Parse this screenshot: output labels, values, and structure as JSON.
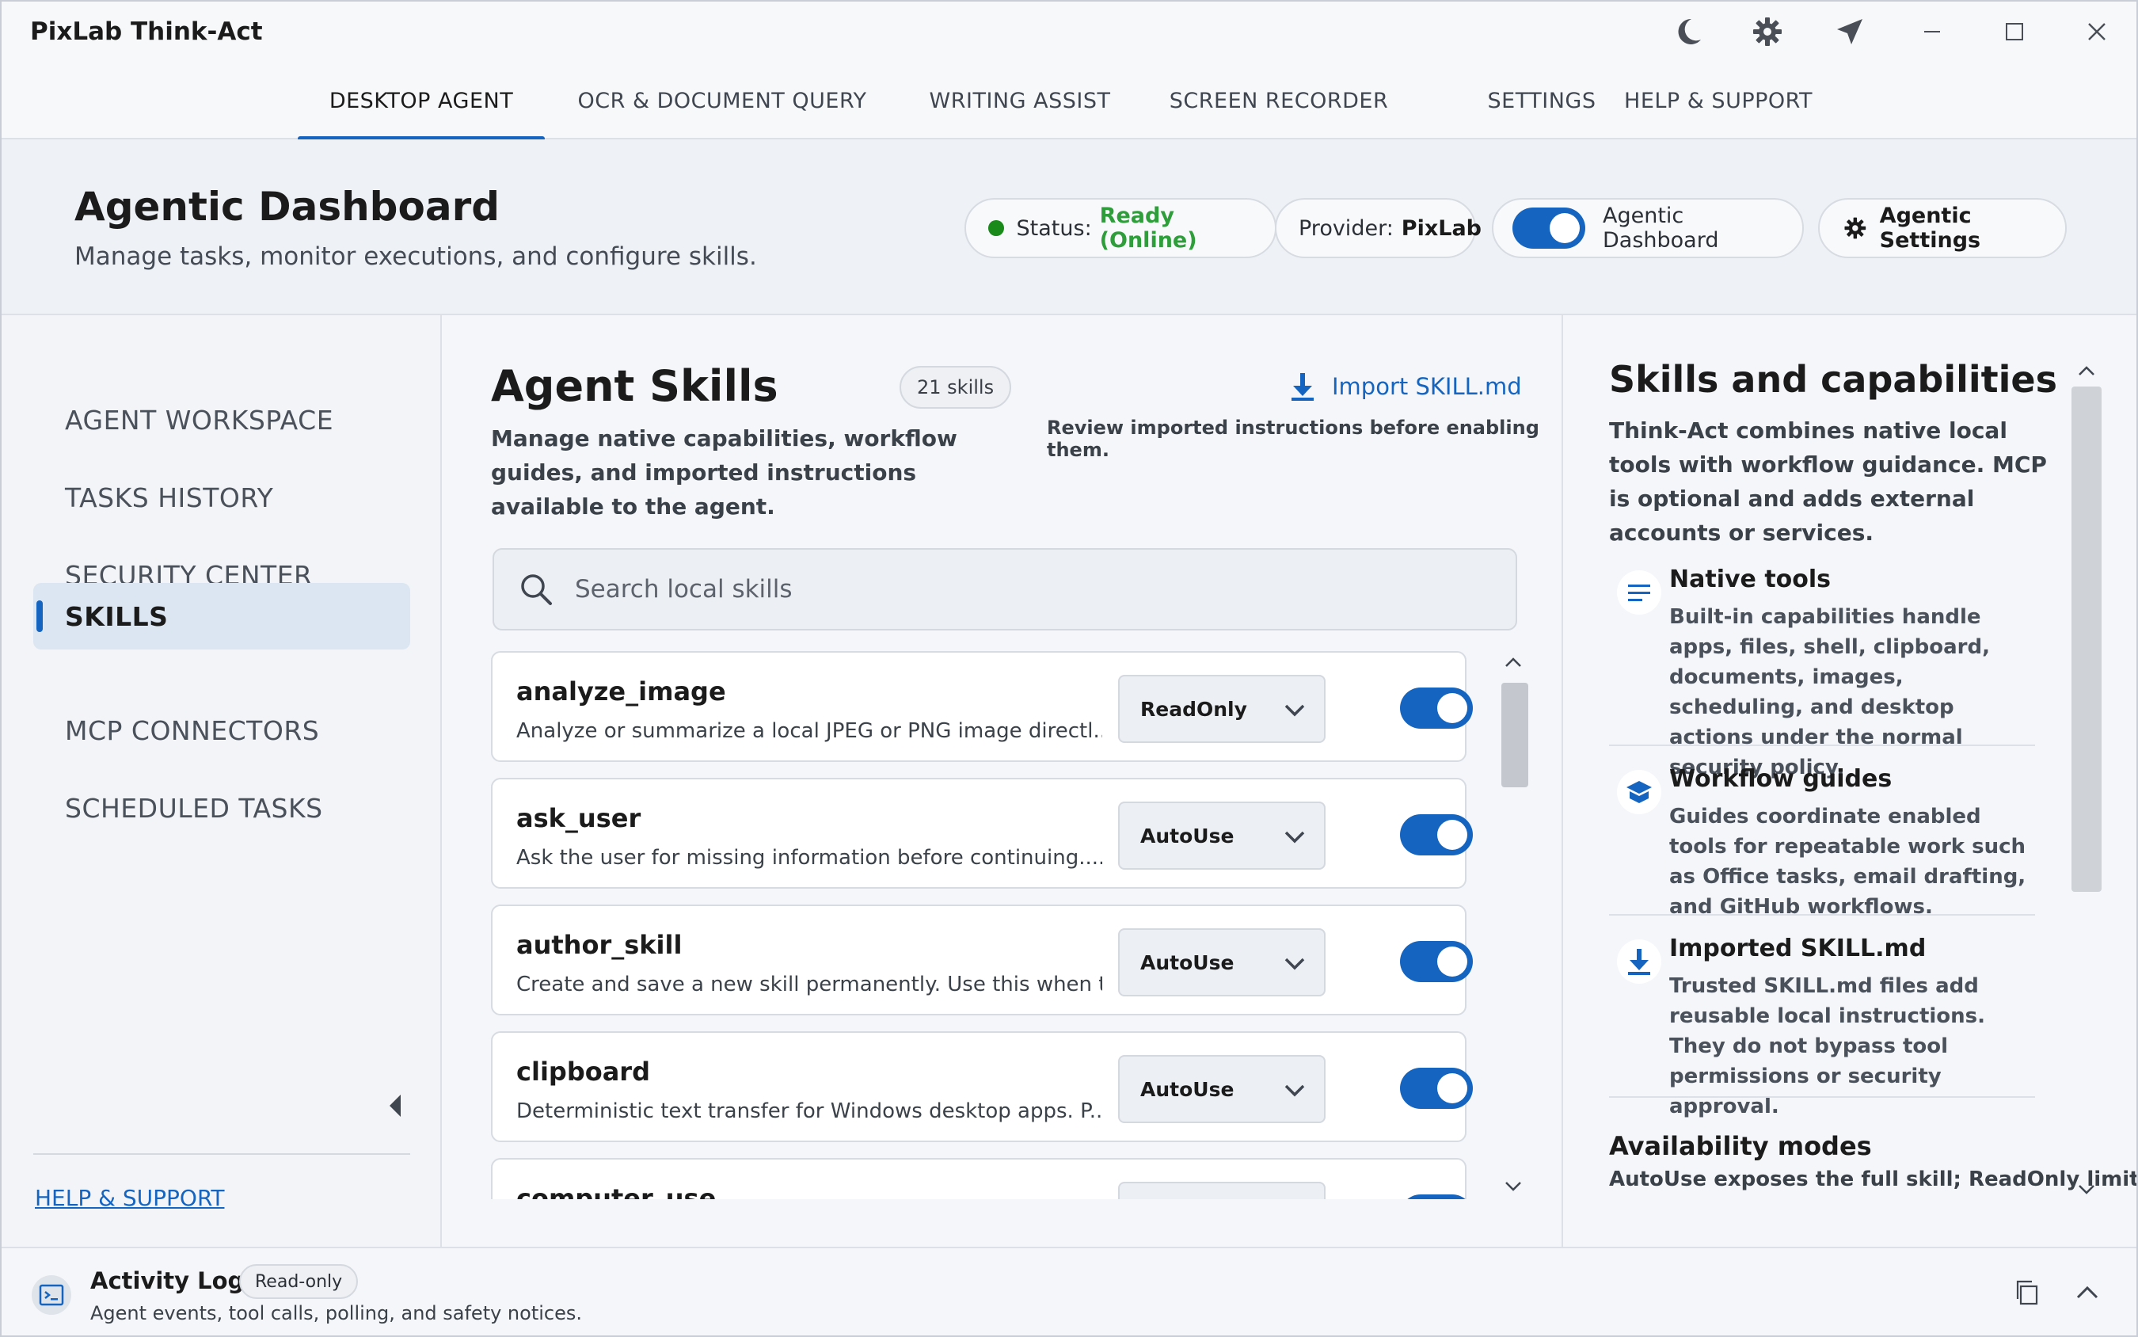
{
  "app": {
    "title": "PixLab Think-Act",
    "title_icons": [
      "moon-icon",
      "gear-icon",
      "send-icon",
      "minimize-icon",
      "maximize-icon",
      "close-icon"
    ]
  },
  "main_tabs": [
    {
      "label": "DESKTOP AGENT",
      "active": true
    },
    {
      "label": "OCR & DOCUMENT QUERY",
      "active": false
    },
    {
      "label": "WRITING ASSIST",
      "active": false
    },
    {
      "label": "SCREEN RECORDER",
      "active": false
    },
    {
      "label": "SETTINGS",
      "active": false
    },
    {
      "label": "HELP & SUPPORT",
      "active": false
    }
  ],
  "header": {
    "title": "Agentic Dashboard",
    "subtitle": "Manage tasks, monitor executions, and configure skills.",
    "status_label": "Status:",
    "status_value": "Ready (Online)",
    "provider_label": "Provider:",
    "provider_value": "PixLab",
    "agentic_toggle_label": "Agentic Dashboard",
    "agentic_toggle_on": true,
    "settings_label": "Agentic Settings"
  },
  "sidebar": {
    "items": [
      {
        "label": "AGENT WORKSPACE",
        "active": false
      },
      {
        "label": "TASKS HISTORY",
        "active": false
      },
      {
        "label": "SECURITY CENTER",
        "active": false
      },
      {
        "label": "SKILLS",
        "active": true
      },
      {
        "label": "MCP CONNECTORS",
        "active": false
      },
      {
        "label": "SCHEDULED TASKS",
        "active": false
      }
    ],
    "help_link": "HELP & SUPPORT"
  },
  "skills_panel": {
    "title": "Agent Skills",
    "count_badge": "21 skills",
    "description": "Manage native capabilities, workflow guides, and imported instructions available to the agent.",
    "import_label": "Import SKILL.md",
    "import_note": "Review imported instructions before enabling them.",
    "search_placeholder": "Search local skills",
    "skills": [
      {
        "name": "analyze_image",
        "desc": "Analyze or summarize a local JPEG or PNG image directl...",
        "mode": "ReadOnly",
        "enabled": true
      },
      {
        "name": "ask_user",
        "desc": "Ask the user for missing information before continuing....",
        "mode": "AutoUse",
        "enabled": true
      },
      {
        "name": "author_skill",
        "desc": "Create and save a new skill permanently. Use this when t...",
        "mode": "AutoUse",
        "enabled": true
      },
      {
        "name": "clipboard",
        "desc": "Deterministic text transfer for Windows desktop apps. P...",
        "mode": "AutoUse",
        "enabled": true
      },
      {
        "name": "computer_use",
        "desc": "",
        "mode": "",
        "enabled": true
      }
    ]
  },
  "capabilities_panel": {
    "title": "Skills and capabilities",
    "intro": "Think-Act combines native local tools with workflow guidance. MCP is optional and adds external accounts or services.",
    "items": [
      {
        "title": "Native tools",
        "body": "Built-in capabilities handle apps, files, shell, clipboard, documents, images, scheduling, and desktop actions under the normal security policy.",
        "icon": "list-icon"
      },
      {
        "title": "Workflow guides",
        "body": "Guides coordinate enabled tools for repeatable work such as Office tasks, email drafting, and GitHub workflows.",
        "icon": "layers-icon"
      },
      {
        "title": "Imported SKILL.md",
        "body": "Trusted SKILL.md files add reusable local instructions. They do not bypass tool permissions or security approval.",
        "icon": "download-icon"
      }
    ],
    "modes_title": "Availability modes",
    "modes_body": "AutoUse exposes the full skill; ReadOnly limits"
  },
  "activity": {
    "title": "Activity Logs",
    "badge": "Read-only",
    "subtitle": "Agent events, tool calls, polling, and safety notices."
  },
  "colors": {
    "accent": "#1565c0",
    "status_ok": "#2e9e3a",
    "status_dot": "#1a8a1a"
  }
}
